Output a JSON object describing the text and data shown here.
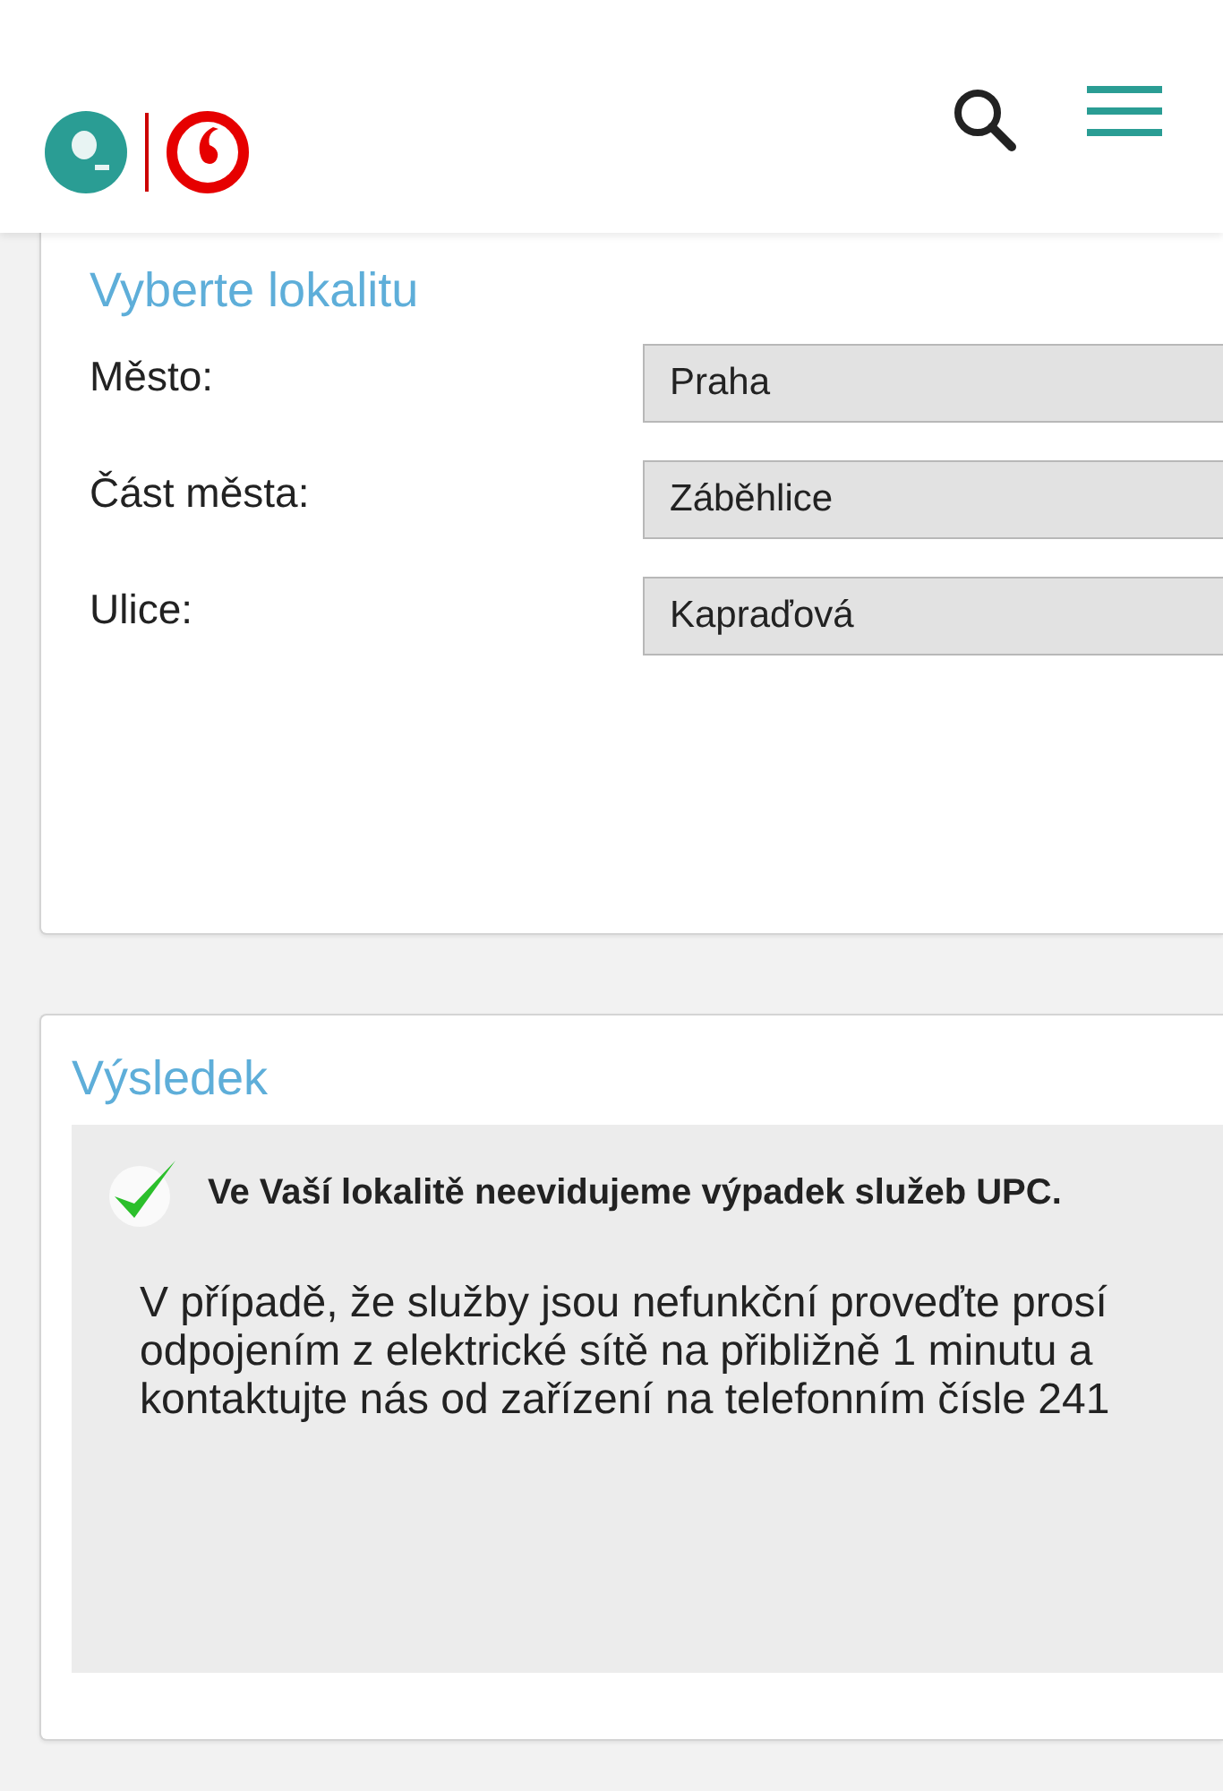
{
  "location": {
    "title": "Vyberte lokalitu",
    "fields": [
      {
        "label": "Město:",
        "value": "Praha"
      },
      {
        "label": "Část města:",
        "value": "Záběhlice"
      },
      {
        "label": "Ulice:",
        "value": "Kapraďová"
      }
    ]
  },
  "result": {
    "title": "Výsledek",
    "message": "Ve Vaší lokalitě neevidujeme výpadek služeb UPC.",
    "lines": [
      "V případě, že služby jsou nefunkční proveďte prosí",
      "odpojením z elektrické sítě na přibližně 1 minutu a",
      "kontaktujte nás od zařízení na telefonním čísle 241"
    ]
  }
}
